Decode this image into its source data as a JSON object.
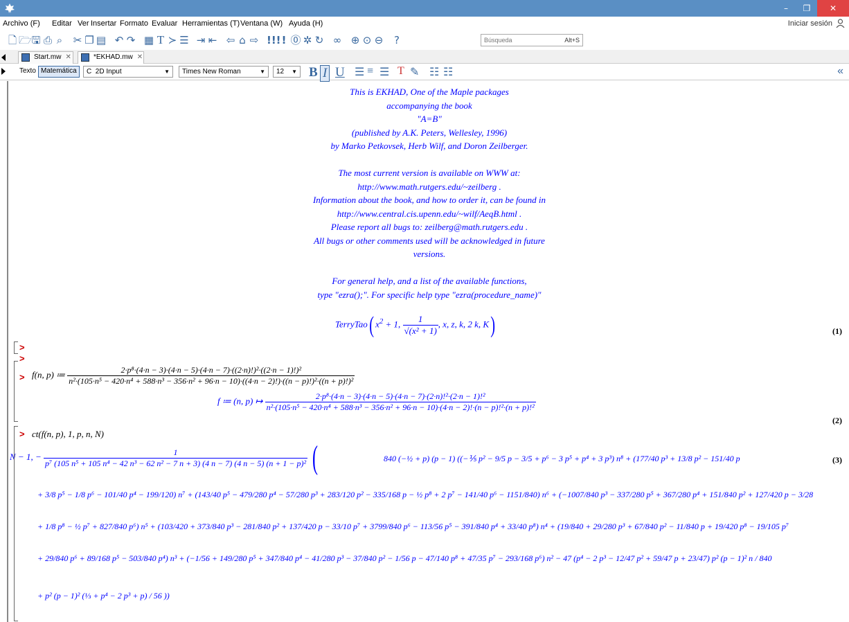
{
  "menu": {
    "items": [
      "Archivo (F)",
      "Editar",
      "Ver",
      "Insertar",
      "Formato",
      "Evaluar",
      "Herramientas (T)",
      "Ventana (W)",
      "Ayuda (H)"
    ],
    "signin": "Iniciar sesión"
  },
  "search": {
    "placeholder": "Búsqueda",
    "shortcut": "Alt+S"
  },
  "tabs": [
    {
      "label": "Start.mw"
    },
    {
      "label": "*EKHAD.mw"
    }
  ],
  "format": {
    "text_mode": "Texto",
    "math_mode": "Matemática",
    "input_type": "2D Input",
    "input_prefix": "C",
    "font": "Times New Roman",
    "size": "12",
    "bold": "B",
    "italic": "I",
    "underline": "U"
  },
  "banner": [
    "This is EKHAD, One of the Maple packages",
    "accompanying the book",
    "\"A=B\"",
    "(published by A.K. Peters, Wellesley, 1996)",
    "by Marko Petkovsek, Herb Wilf, and Doron Zeilberger.",
    "",
    "The most current version is available on WWW at:",
    "http://www.math.rutgers.edu/~zeilberg .",
    "Information about the book, and how to order it, can be found in",
    "http://www.central.cis.upenn.edu/~wilf/AeqB.html .",
    "Please report all bugs to: zeilberg@math.rutgers.edu .",
    "All bugs or other comments used will be acknowledged in future",
    "versions.",
    "",
    "For general help, and a list of the available functions,",
    "type \"ezra();\". For specific help type \"ezra(procedure_name)\""
  ],
  "output1": {
    "head": "TerryTao",
    "args_prefix": "x",
    "sq": "2",
    "plus1": " + 1, ",
    "frac_num": "1",
    "frac_den": "√(x² + 1)",
    "args_suffix": ", x, z, k, 2 k, K",
    "label": "(1)"
  },
  "prompts": {
    "symbol": ">"
  },
  "input2": {
    "lhs": "f(n, p) ≔",
    "num": "2·p⁸·(4·n − 3)·(4·n − 5)·(4·n − 7)·((2·n)!)²·((2·n − 1)!)²",
    "den": "n²·(105·n⁵ − 420·n⁴ + 588·n³ − 356·n² + 96·n − 10)·((4·n − 2)!)·((n − p)!)²·((n + p)!)²"
  },
  "output2": {
    "lhs": "f ≔ (n, p) ↦",
    "num": "2·p⁸·(4·n − 3)·(4·n − 5)·(4·n − 7)·(2·n)!²·(2·n − 1)!²",
    "den": "n²·(105·n⁵ − 420·n⁴ + 588·n³ − 356·n² + 96·n − 10)·(4·n − 2)!·(n − p)!²·(n + p)!²",
    "label": "(2)"
  },
  "input3": {
    "text": "ct(f(n, p), 1, p, n, N)"
  },
  "output3": {
    "label": "(3)",
    "lead": "N − 1, −",
    "lead_num": "1",
    "lead_den": "p⁷ (105 n⁵ + 105 n⁴ − 42 n³ − 62 n² − 7 n + 3) (4 n − 7) (4 n − 5) (n + 1 − p)²",
    "line1": "840 (−½ + p) (p − 1) ((−⅕ p² − 9/5 p − 3/5 + p⁶ − 3 p⁵ + p⁴ + 3 p³) n⁸ + (177/40 p³ + 13/8 p² − 151/40 p",
    "line2": "+ 3/8 p⁵ − 1/8 p⁶ − 101/40 p⁴ − 199/120) n⁷ + (143/40 p⁵ − 479/280 p⁴ − 57/280 p³ + 283/120 p² − 335/168 p − ½ p⁸ + 2 p⁷ − 141/40 p⁶ − 1151/840) n⁶ + (−1007/840 p³ − 337/280 p⁵ + 367/280 p⁴ + 151/840 p² + 127/420 p − 3/28",
    "line3": "+ 1/8 p⁸ − ½ p⁷ + 827/840 p⁶) n⁵ + (103/420 + 373/840 p³ − 281/840 p² + 137/420 p − 33/10 p⁷ + 3799/840 p⁶ − 113/56 p⁵ − 391/840 p⁴ + 33/40 p⁸) n⁴ + (19/840 + 29/280 p³ + 67/840 p² − 11/840 p + 19/420 p⁸ − 19/105 p⁷",
    "line4": "+ 29/840 p⁶ + 89/168 p⁵ − 503/840 p⁴) n³ + (−1/56 + 149/280 p⁵ + 347/840 p⁴ − 41/280 p³ − 37/840 p² − 1/56 p − 47/140 p⁸ + 47/35 p⁷ − 293/168 p⁶) n² − 47 (p⁴ − 2 p³ − 12/47 p² + 59/47 p + 23/47) p² (p − 1)² n / 840",
    "line5": "+ p² (p − 1)² (⅓ + p⁴ − 2 p³ + p) / 56 ))"
  }
}
